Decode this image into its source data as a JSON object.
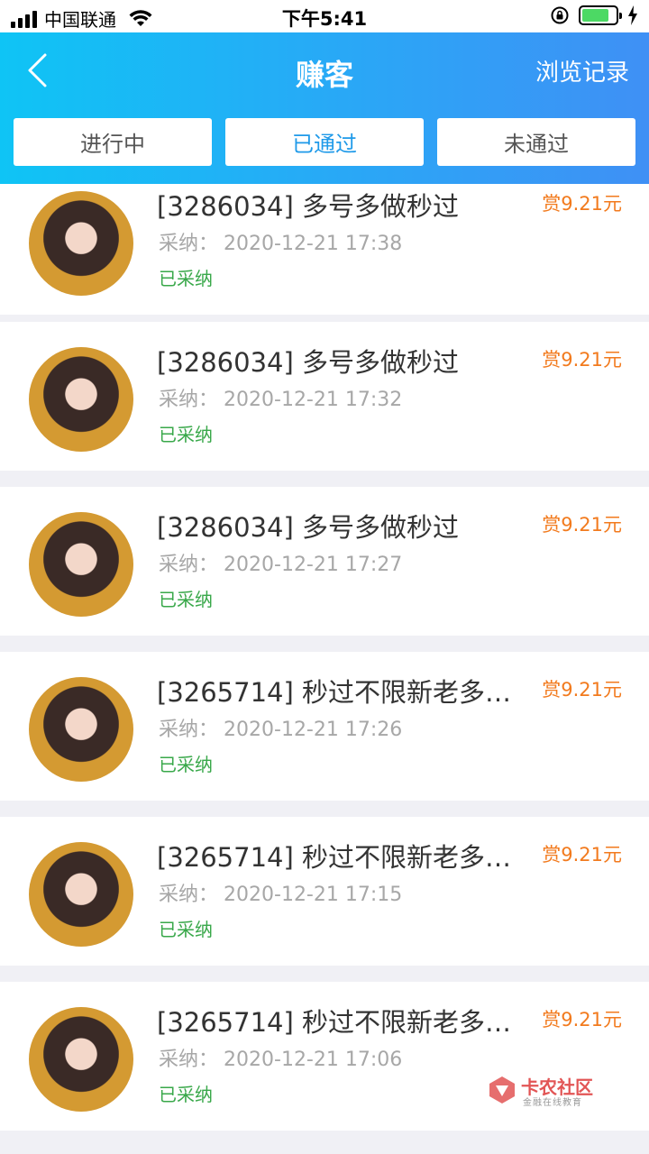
{
  "status_bar": {
    "carrier": "中国联通",
    "time": "下午5:41",
    "battery_level": 0.8
  },
  "nav": {
    "back_icon": "chevron-left-icon",
    "title": "赚客",
    "right_action": "浏览记录"
  },
  "tabs": [
    {
      "label": "进行中",
      "active": false
    },
    {
      "label": "已通过",
      "active": true
    },
    {
      "label": "未通过",
      "active": false
    }
  ],
  "colors": {
    "header_gradient_start": "#0fc4f5",
    "header_gradient_end": "#3f90f5",
    "active_tab": "#1f9ae9",
    "reward": "#f27a1d",
    "status_text": "#39a84a"
  },
  "list": {
    "items": [
      {
        "title": "[3286034] 多号多做秒过",
        "meta_label": "采纳：",
        "meta_time": "2020-12-21 17:38",
        "status": "已采纳",
        "reward": "赏9.21元"
      },
      {
        "title": "[3286034] 多号多做秒过",
        "meta_label": "采纳：",
        "meta_time": "2020-12-21 17:32",
        "status": "已采纳",
        "reward": "赏9.21元"
      },
      {
        "title": "[3286034] 多号多做秒过",
        "meta_label": "采纳：",
        "meta_time": "2020-12-21 17:27",
        "status": "已采纳",
        "reward": "赏9.21元"
      },
      {
        "title": "[3265714] 秒过不限新老多…",
        "meta_label": "采纳：",
        "meta_time": "2020-12-21 17:26",
        "status": "已采纳",
        "reward": "赏9.21元"
      },
      {
        "title": "[3265714] 秒过不限新老多…",
        "meta_label": "采纳：",
        "meta_time": "2020-12-21 17:15",
        "status": "已采纳",
        "reward": "赏9.21元"
      },
      {
        "title": "[3265714] 秒过不限新老多…",
        "meta_label": "采纳：",
        "meta_time": "2020-12-21 17:06",
        "status": "已采纳",
        "reward": "赏9.21元"
      }
    ]
  },
  "watermark": {
    "title": "卡农社区",
    "subtitle": "金融在线教育"
  }
}
